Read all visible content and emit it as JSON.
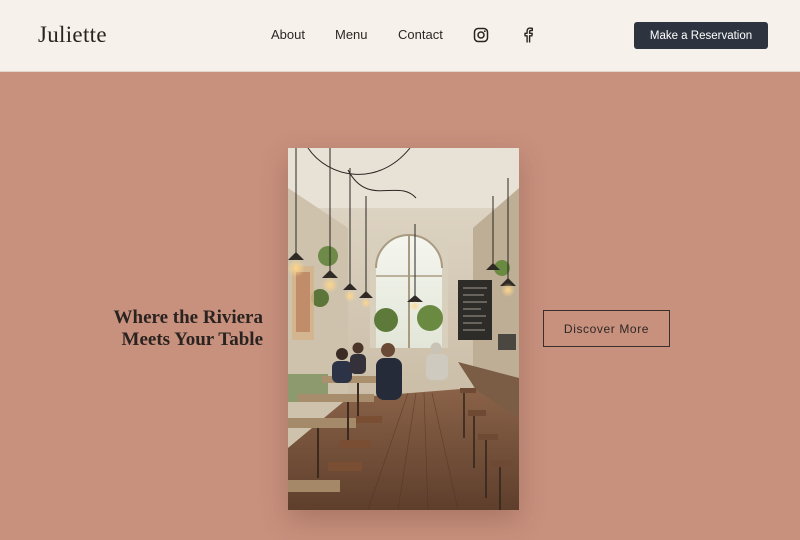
{
  "header": {
    "logo": "Juliette",
    "nav": [
      {
        "label": "About"
      },
      {
        "label": "Menu"
      },
      {
        "label": "Contact"
      }
    ],
    "social": [
      {
        "icon": "instagram-icon"
      },
      {
        "icon": "facebook-icon"
      }
    ],
    "cta_label": "Make a Reservation"
  },
  "hero": {
    "headline_line1": "Where the Riviera",
    "headline_line2": "Meets Your Table",
    "cta_label": "Discover More"
  },
  "colors": {
    "background": "#c8917e",
    "header_bg": "#f6f1ea",
    "button_dark": "#2d3440",
    "text_dark": "#2b2320"
  }
}
